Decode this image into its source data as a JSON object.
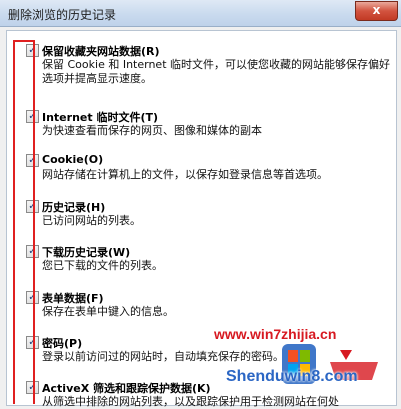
{
  "window": {
    "title": "删除浏览的历史记录",
    "close_glyph": "x"
  },
  "items": [
    {
      "label": "保留收藏夹网站数据(R)",
      "desc": "保留 Cookie 和 Internet 临时文件，可以使您收藏的网站能够保存偏好选项并提高显示速度。",
      "checked": true
    },
    {
      "label": "Internet 临时文件(T)",
      "desc": "为快速查看而保存的网页、图像和媒体的副本",
      "checked": true
    },
    {
      "label": "Cookie(O)",
      "desc": "网站存储在计算机上的文件，以保存如登录信息等首选项。",
      "checked": true
    },
    {
      "label": "历史记录(H)",
      "desc": "已访问网站的列表。",
      "checked": true
    },
    {
      "label": "下载历史记录(W)",
      "desc": "您已下载的文件的列表。",
      "checked": true
    },
    {
      "label": "表单数据(F)",
      "desc": "保存在表单中键入的信息。",
      "checked": true
    },
    {
      "label": "密码(P)",
      "desc": "登录以前访问过的网站时，自动填充保存的密码。",
      "checked": true
    },
    {
      "label": "ActiveX 筛选和跟踪保护数据(K)",
      "desc": "从筛选中排除的网站列表，以及跟踪保护用于检测网站在何处",
      "checked": true
    }
  ],
  "watermark": {
    "url": "www.win7zhijia.cn",
    "brand": "Shenduwin8.com"
  },
  "colors": {
    "highlight_box": "#e02020",
    "title_bg": "#c9daee",
    "close_bg": "#d2533f"
  },
  "icons": {
    "checkbox": "check-icon",
    "close": "close-icon",
    "logo": "windows-logo-icon"
  }
}
